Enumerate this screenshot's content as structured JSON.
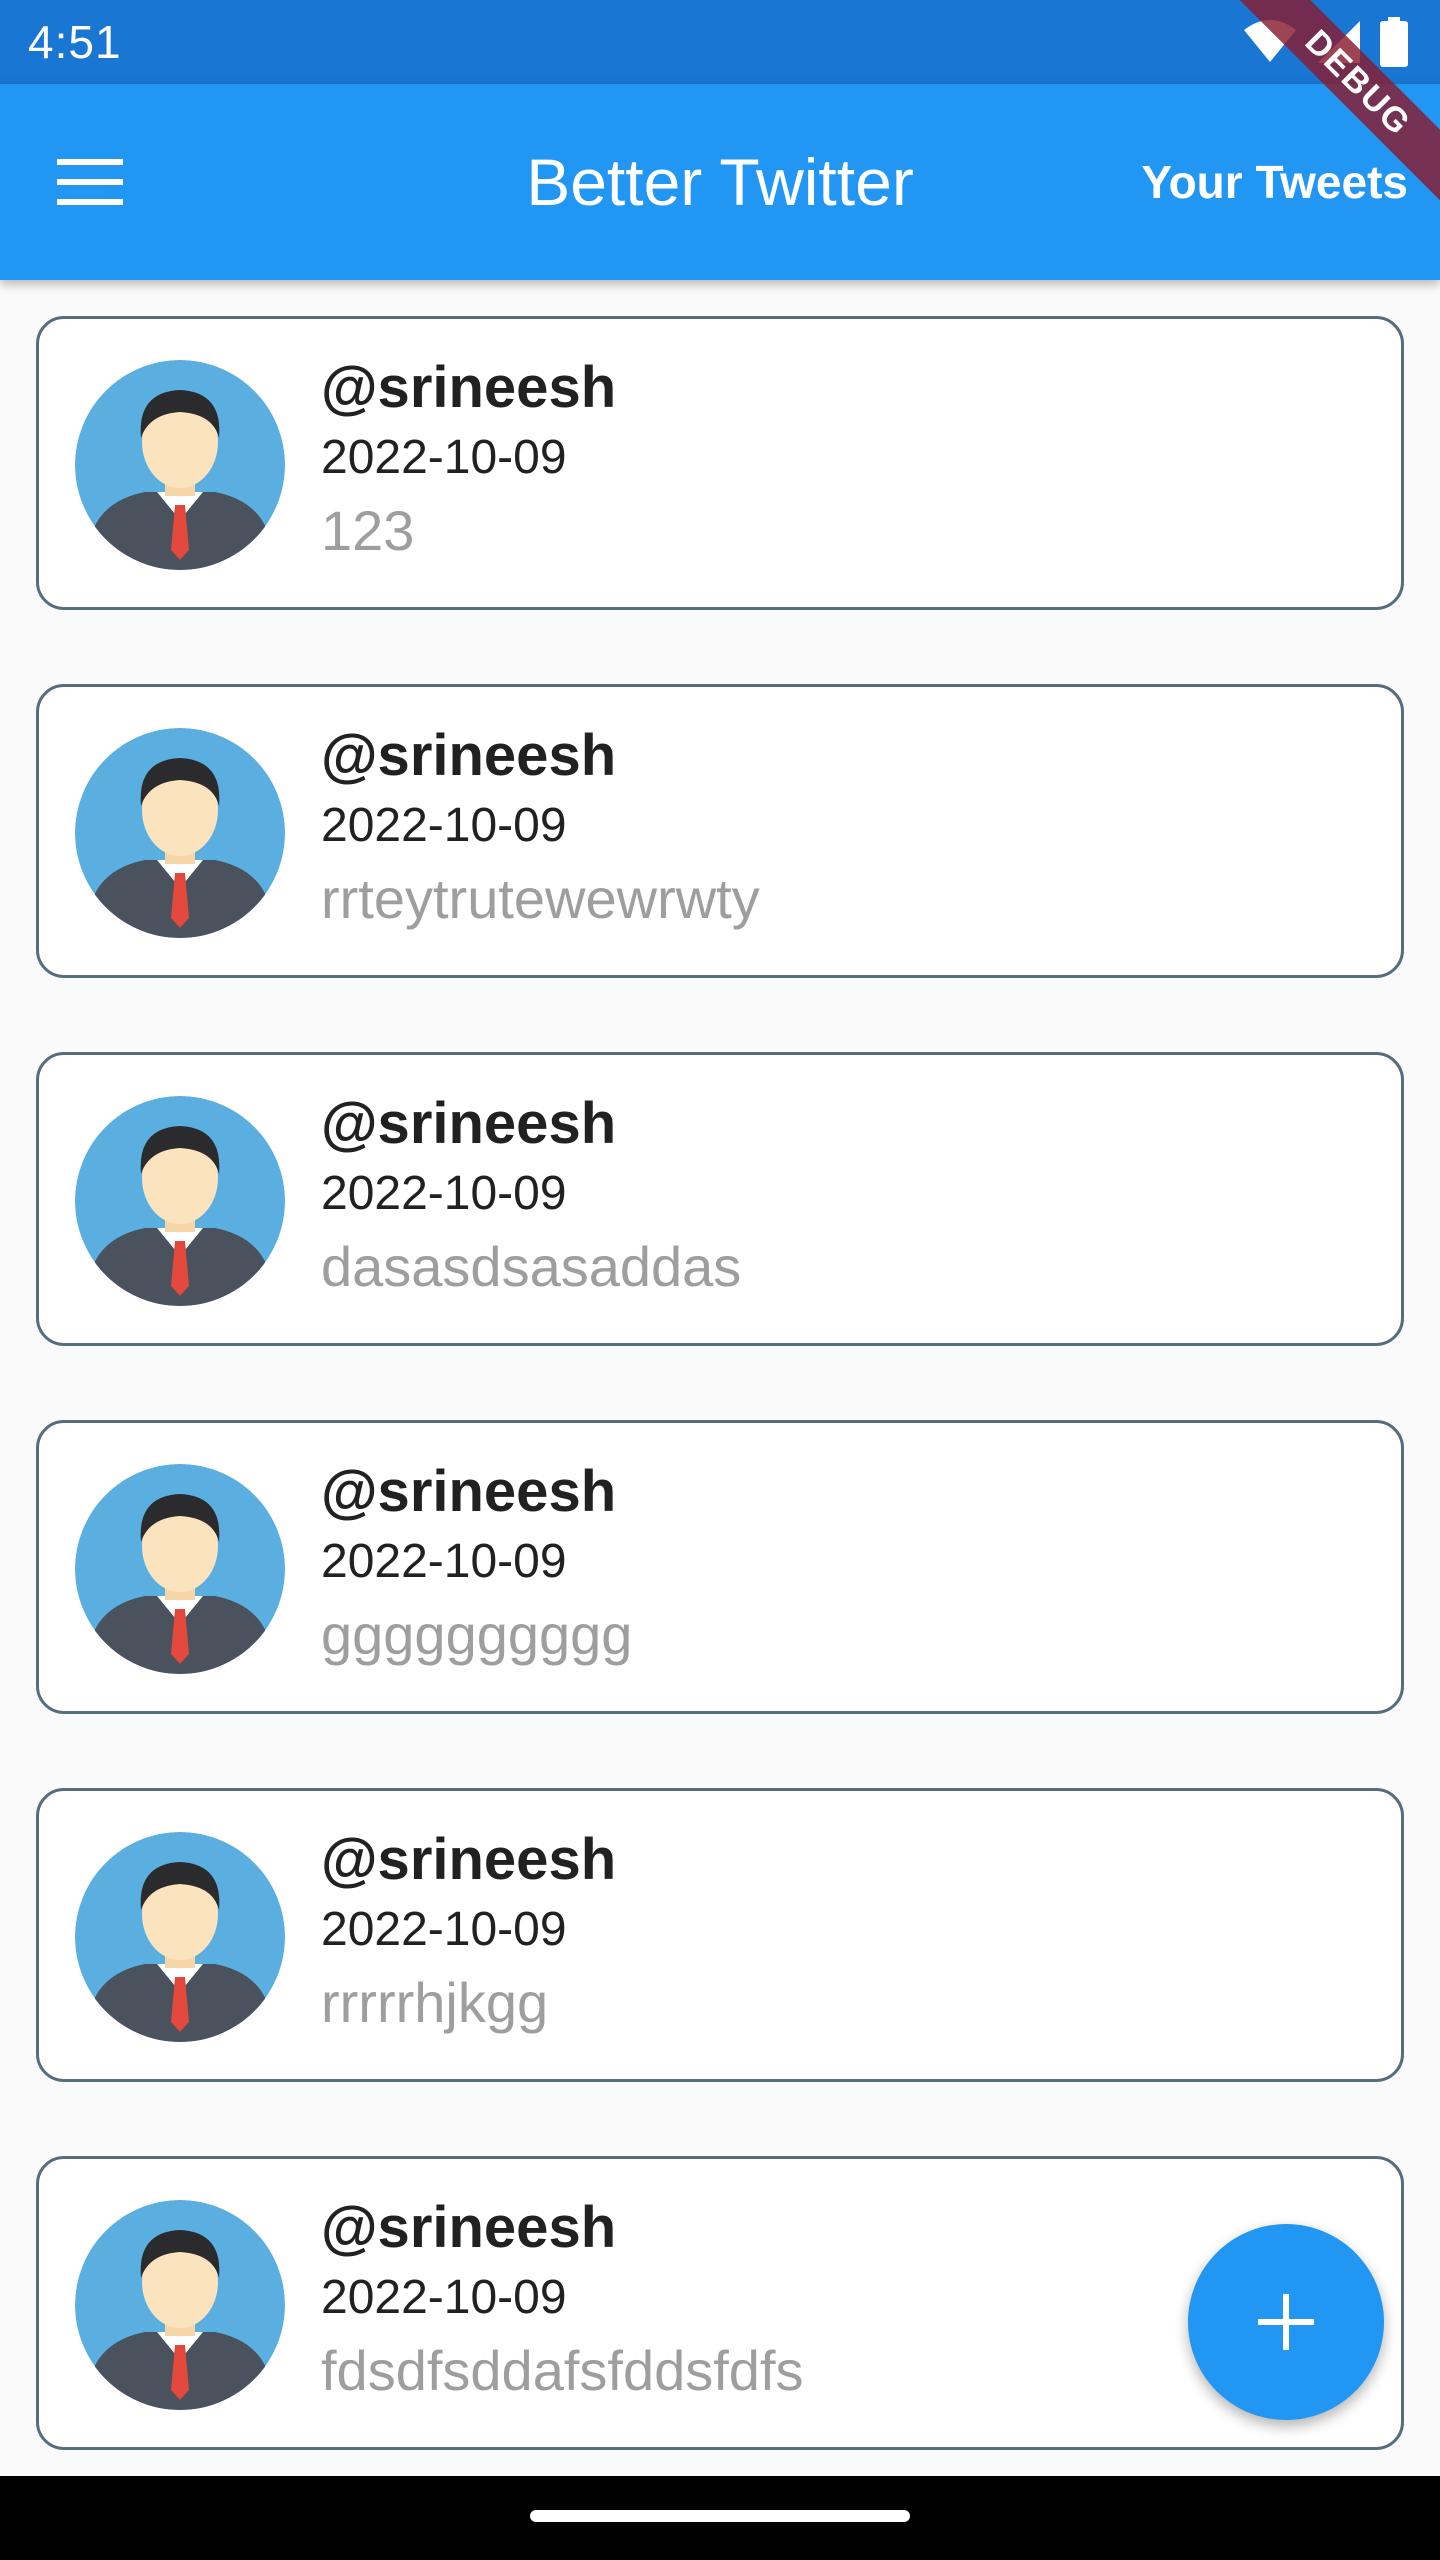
{
  "status_bar": {
    "time": "4:51"
  },
  "debug_banner": "DEBUG",
  "app_bar": {
    "title": "Better Twitter",
    "action_label": "Your Tweets",
    "menu_icon": "hamburger-menu-icon"
  },
  "tweets": [
    {
      "handle": "@srineesh",
      "date": "2022-10-09",
      "content": "123"
    },
    {
      "handle": "@srineesh",
      "date": "2022-10-09",
      "content": "rrteytrutewewrwty"
    },
    {
      "handle": "@srineesh",
      "date": "2022-10-09",
      "content": "dasasdsasaddas"
    },
    {
      "handle": "@srineesh",
      "date": "2022-10-09",
      "content": "gggggggggg"
    },
    {
      "handle": "@srineesh",
      "date": "2022-10-09",
      "content": "rrrrrhjkgg"
    },
    {
      "handle": "@srineesh",
      "date": "2022-10-09",
      "content": "fdsdfsddafsfddsfdfs"
    }
  ],
  "fab": {
    "icon": "plus-icon"
  },
  "colors": {
    "primary": "#2196f3",
    "status_bar": "#1976d2",
    "card_border": "#546e7a",
    "content_text": "#9e9e9e"
  }
}
